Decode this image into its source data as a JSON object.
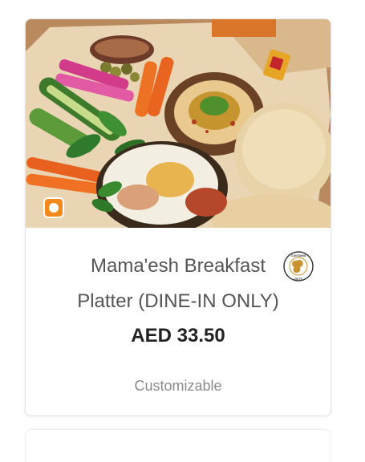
{
  "product": {
    "name_line1": "Mama'esh Breakfast",
    "name_line2": "Platter (DINE-IN ONLY)",
    "price": "AED 33.50",
    "option_text": "Customizable",
    "image_label": "Mama'esh Breakfast Platter photo",
    "veg_indicator": "veg-indicator-icon",
    "allergen_badge": {
      "icon": "peanut-icon",
      "label_top": "CONTAINS",
      "label_bottom": "NUTS"
    }
  },
  "colors": {
    "veg_badge": "#f28a1b",
    "nuts_badge_ring": "#c8932e",
    "price_text": "#222222",
    "title_text": "#555555",
    "option_text": "#8a8a8a"
  }
}
